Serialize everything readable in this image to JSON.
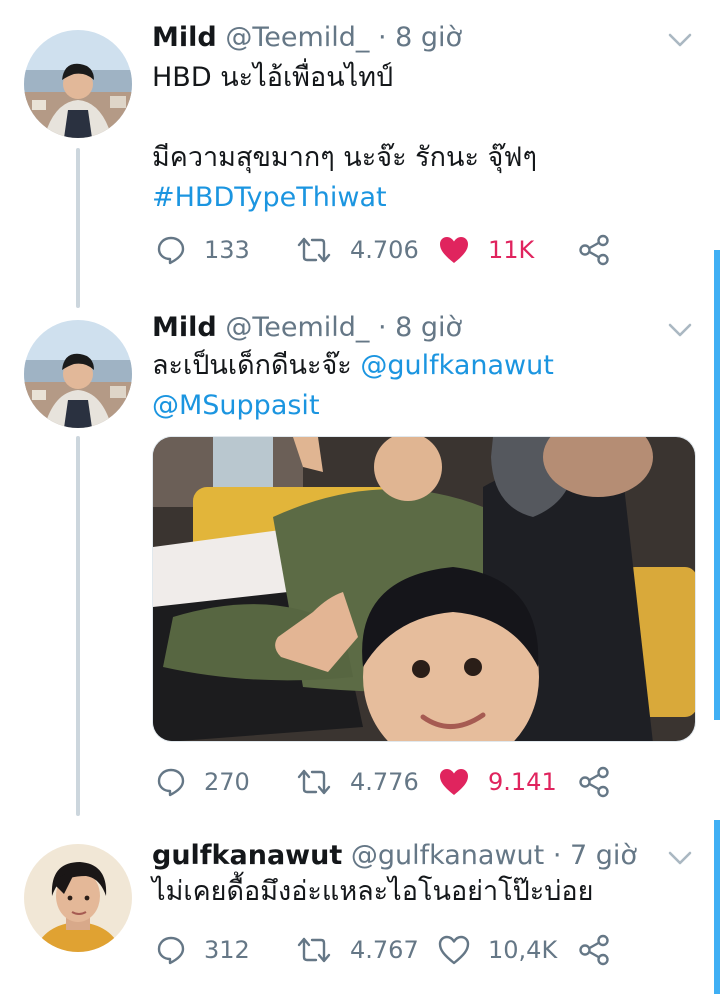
{
  "colors": {
    "accent": "#1da1f2",
    "link": "#1b95e0",
    "like": "#e0245e",
    "muted": "#657786",
    "line": "#ccd6dd"
  },
  "tweets": [
    {
      "name": "Mild",
      "handle": "@Teemild_",
      "time": "· 8 giờ",
      "text_line1": "HBD นะไอ้เพื่อนไทป์",
      "text_line2": "มีความสุขมากๆ นะจ๊ะ รักนะ จุ๊ฟๆ",
      "hashtag": "#HBDTypeThiwat",
      "replies": "133",
      "retweets": "4.706",
      "likes": "11K",
      "liked": true
    },
    {
      "name": "Mild",
      "handle": "@Teemild_",
      "time": "· 8 giờ",
      "text": "ละเป็นเด็กดีนะจ๊ะ",
      "mention1": "@gulfkanawut",
      "mention2": "@MSuppasit",
      "replies": "270",
      "retweets": "4.776",
      "likes": "9.141",
      "liked": true
    },
    {
      "name": "gulfkanawut",
      "handle": "@gulfkanawut",
      "time": "· 7 giờ",
      "text": "ไม่เคยดื้อมึงอ่ะแหละไอโนอย่าโป๊ะบ่อย",
      "replies": "312",
      "retweets": "4.767",
      "likes": "10,4K",
      "liked": false
    }
  ],
  "icons": [
    "reply-icon",
    "retweet-icon",
    "like-icon",
    "share-icon",
    "chevron-down-icon"
  ]
}
